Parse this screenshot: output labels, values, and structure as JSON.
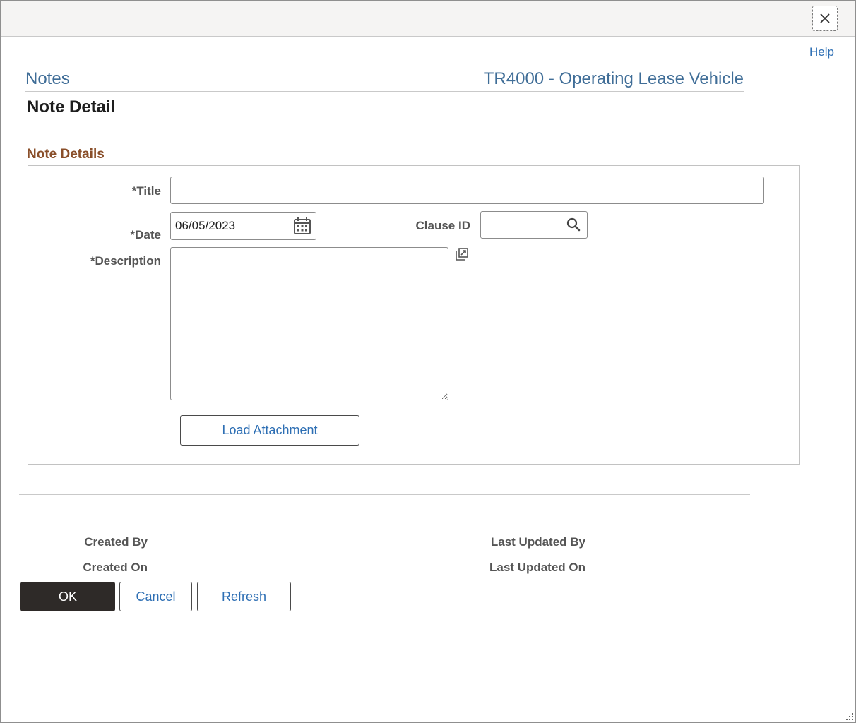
{
  "window": {
    "close_icon": "close-icon",
    "help_label": "Help"
  },
  "header": {
    "breadcrumb": "Notes",
    "context_title": "TR4000 - Operating Lease Vehicle",
    "page_title": "Note Detail"
  },
  "section": {
    "title": "Note Details"
  },
  "form": {
    "title_label": "*Title",
    "title_value": "",
    "date_label": "*Date",
    "date_value": "06/05/2023",
    "date_icon": "calendar-icon",
    "clause_label": "Clause ID",
    "clause_value": "",
    "clause_icon": "search-icon",
    "description_label": "*Description",
    "description_value": "",
    "expand_icon": "expand-icon",
    "load_attachment_label": "Load Attachment"
  },
  "audit": {
    "created_by_label": "Created By",
    "created_on_label": "Created On",
    "last_updated_by_label": "Last Updated By",
    "last_updated_on_label": "Last Updated On"
  },
  "actions": {
    "ok_label": "OK",
    "cancel_label": "Cancel",
    "refresh_label": "Refresh"
  },
  "colors": {
    "link": "#2e6fb4",
    "breadcrumb": "#3f6d97",
    "section_title": "#8a4f2a",
    "primary_button": "#2e2a28"
  }
}
